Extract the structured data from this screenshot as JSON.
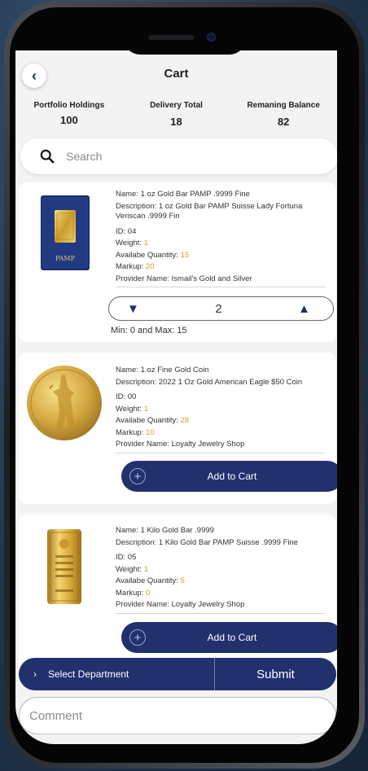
{
  "header": {
    "title": "Cart",
    "back_icon": "chevron-left-icon"
  },
  "stats": [
    {
      "label": "Portfolio Holdings",
      "value": "100"
    },
    {
      "label": "Delivery Total",
      "value": "18"
    },
    {
      "label": "Remaning Balance",
      "value": "82"
    }
  ],
  "search": {
    "placeholder": "Search",
    "icon": "search-icon"
  },
  "items": [
    {
      "name_label": "Name:",
      "name": "1 oz Gold Bar PAMP .9999 Fine",
      "desc_label": "Description:",
      "description": "1 oz Gold Bar PAMP Suisse Lady Fortuna Veriscan .9999 Fin",
      "id_label": "ID:",
      "id": "04",
      "weight_label": "Weight:",
      "weight": "1",
      "qty_label": "Availabe Quantity:",
      "qty": "15",
      "markup_label": "Markup:",
      "markup": "20",
      "provider_label": "Provider Name:",
      "provider": "Ismail's Gold and Silver",
      "stepper": {
        "value": "2",
        "range": "Min: 0 and Max: 15"
      },
      "image_text": "PAMP"
    },
    {
      "name_label": "Name:",
      "name": "1 oz Fine Gold Coin",
      "desc_label": "Description:",
      "description": "2022 1 Oz Gold American Eagle $50 Coin",
      "id_label": "ID:",
      "id": "00",
      "weight_label": "Weight:",
      "weight": "1",
      "qty_label": "Availabe Quantity:",
      "qty": "28",
      "markup_label": "Markup:",
      "markup": "10",
      "provider_label": "Provider Name:",
      "provider": "Loyalty Jewelry Shop",
      "button": "Add to Cart"
    },
    {
      "name_label": "Name:",
      "name": "1 Kilo Gold Bar .9999",
      "desc_label": "Description:",
      "description": "1 Kilo Gold Bar PAMP Suisse .9999 Fine",
      "id_label": "ID:",
      "id": "05",
      "weight_label": "Weight:",
      "weight": "1",
      "qty_label": "Availabe Quantity:",
      "qty": "5",
      "markup_label": "Markup:",
      "markup": "0",
      "provider_label": "Provider Name:",
      "provider": "Loyalty Jewelry Shop",
      "button": "Add to Cart"
    }
  ],
  "bottom": {
    "department": "Select Department",
    "submit": "Submit"
  },
  "comment": {
    "placeholder": "Comment"
  },
  "colors": {
    "primary": "#22306e",
    "gold": "#c9a227",
    "background": "#f3f3f4"
  }
}
